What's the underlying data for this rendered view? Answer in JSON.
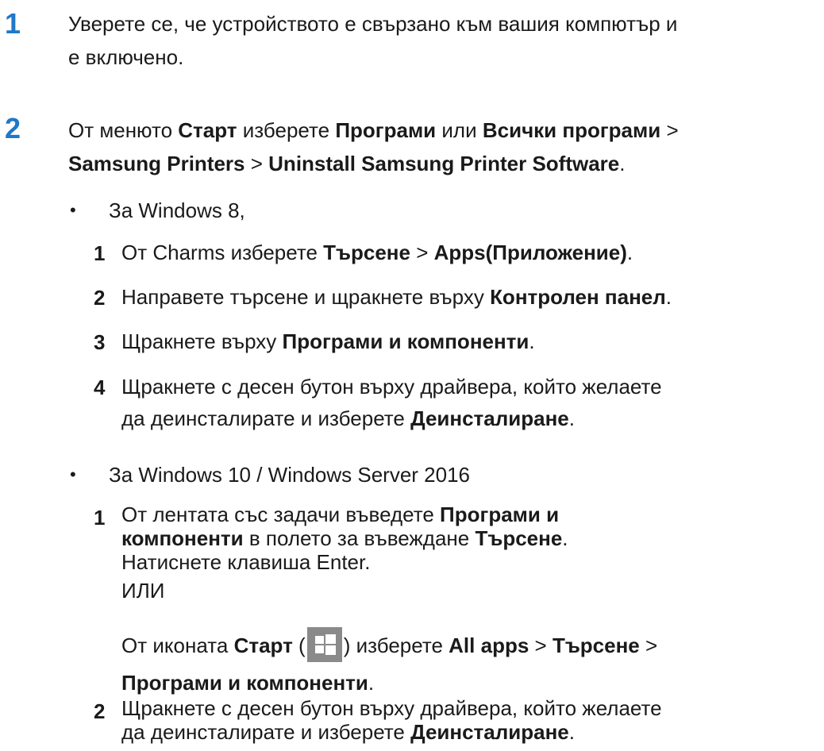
{
  "steps": [
    {
      "number": "1",
      "line1": "Уверете се, че устройството е свързано към вашия компютър и",
      "line2": "е включено."
    },
    {
      "number": "2",
      "t1": "От менюто ",
      "b1": "Старт",
      "t2": " изберете ",
      "b2": "Програми",
      "t3": " или ",
      "b3": "Всички програми",
      "t4": " >",
      "b4": "Samsung Printers",
      "t5": " > ",
      "b5": "Uninstall Samsung Printer Software",
      "t6": "."
    }
  ],
  "bullet_char": "•",
  "win8": {
    "heading": "За Windows 8,",
    "items": [
      {
        "num": "1",
        "t1": "От Charms изберете ",
        "b1": "Търсене",
        "t2": " > ",
        "b2": "Apps(Приложение)",
        "t3": "."
      },
      {
        "num": "2",
        "t1": "Направете търсене и щракнете върху ",
        "b1": "Контролен панел",
        "t2": "."
      },
      {
        "num": "3",
        "t1": "Щракнете върху ",
        "b1": "Програми и компоненти",
        "t2": "."
      },
      {
        "num": "4",
        "line1": "Щракнете с десен бутон върху драйвера, който желаете",
        "t2": "да деинсталирате и изберете ",
        "b1": "Деинсталиране",
        "t3": "."
      }
    ]
  },
  "win10": {
    "heading": "За Windows 10 / Windows Server 2016",
    "item1": {
      "num": "1",
      "t1": "От лентата със задачи въведете ",
      "b1": "Програми и",
      "b2": "компоненти",
      "t2": " в полето за въвеждане ",
      "b3": "Търсене",
      "t3": ".",
      "line3": "Натиснете клавиша Enter.",
      "or": "ИЛИ",
      "s1": "От иконата ",
      "sb1": "Старт",
      "s2": " (",
      "s3": ") изберете ",
      "sb2": "All apps",
      "s4": " > ",
      "sb3": "Търсене",
      "s5": " >",
      "sb4": "Програми и компоненти",
      "s6": "."
    },
    "item2": {
      "num": "2",
      "line1": "Щракнете с десен бутон върху драйвера, който желаете",
      "t2": "да деинсталирате и изберете ",
      "b1": "Деинсталиране",
      "t3": "."
    }
  },
  "icons": {
    "start_button": "windows-start-icon",
    "icon_bg": "#8a8a8a"
  },
  "colors": {
    "step_number": "#1f78c8",
    "text": "#1a1a1a"
  }
}
